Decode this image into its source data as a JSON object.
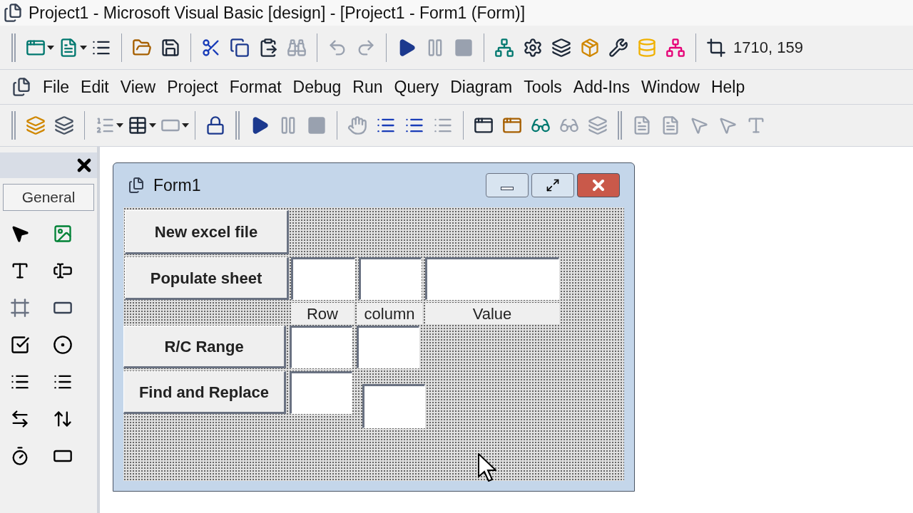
{
  "window": {
    "title": "Project1 - Microsoft Visual Basic [design] - [Project1 - Form1 (Form)]"
  },
  "standard_toolbar": {
    "coordinates": "1710, 159"
  },
  "menu": [
    {
      "label": "File"
    },
    {
      "label": "Edit"
    },
    {
      "label": "View"
    },
    {
      "label": "Project"
    },
    {
      "label": "Format"
    },
    {
      "label": "Debug"
    },
    {
      "label": "Run"
    },
    {
      "label": "Query"
    },
    {
      "label": "Diagram"
    },
    {
      "label": "Tools"
    },
    {
      "label": "Add-Ins"
    },
    {
      "label": "Window"
    },
    {
      "label": "Help"
    }
  ],
  "toolbox": {
    "tab": "General"
  },
  "form": {
    "title": "Form1",
    "controls": [
      {
        "kind": "button",
        "text": "New excel file"
      },
      {
        "kind": "button",
        "text": "Populate sheet"
      },
      {
        "kind": "textbox"
      },
      {
        "kind": "textbox"
      },
      {
        "kind": "textbox"
      },
      {
        "kind": "label",
        "text": "Row"
      },
      {
        "kind": "label",
        "text": "column"
      },
      {
        "kind": "label",
        "text": "Value"
      },
      {
        "kind": "button",
        "text": "R/C Range"
      },
      {
        "kind": "textbox"
      },
      {
        "kind": "textbox"
      },
      {
        "kind": "button",
        "text": "Find and Replace"
      },
      {
        "kind": "textbox"
      },
      {
        "kind": "textbox"
      }
    ]
  }
}
